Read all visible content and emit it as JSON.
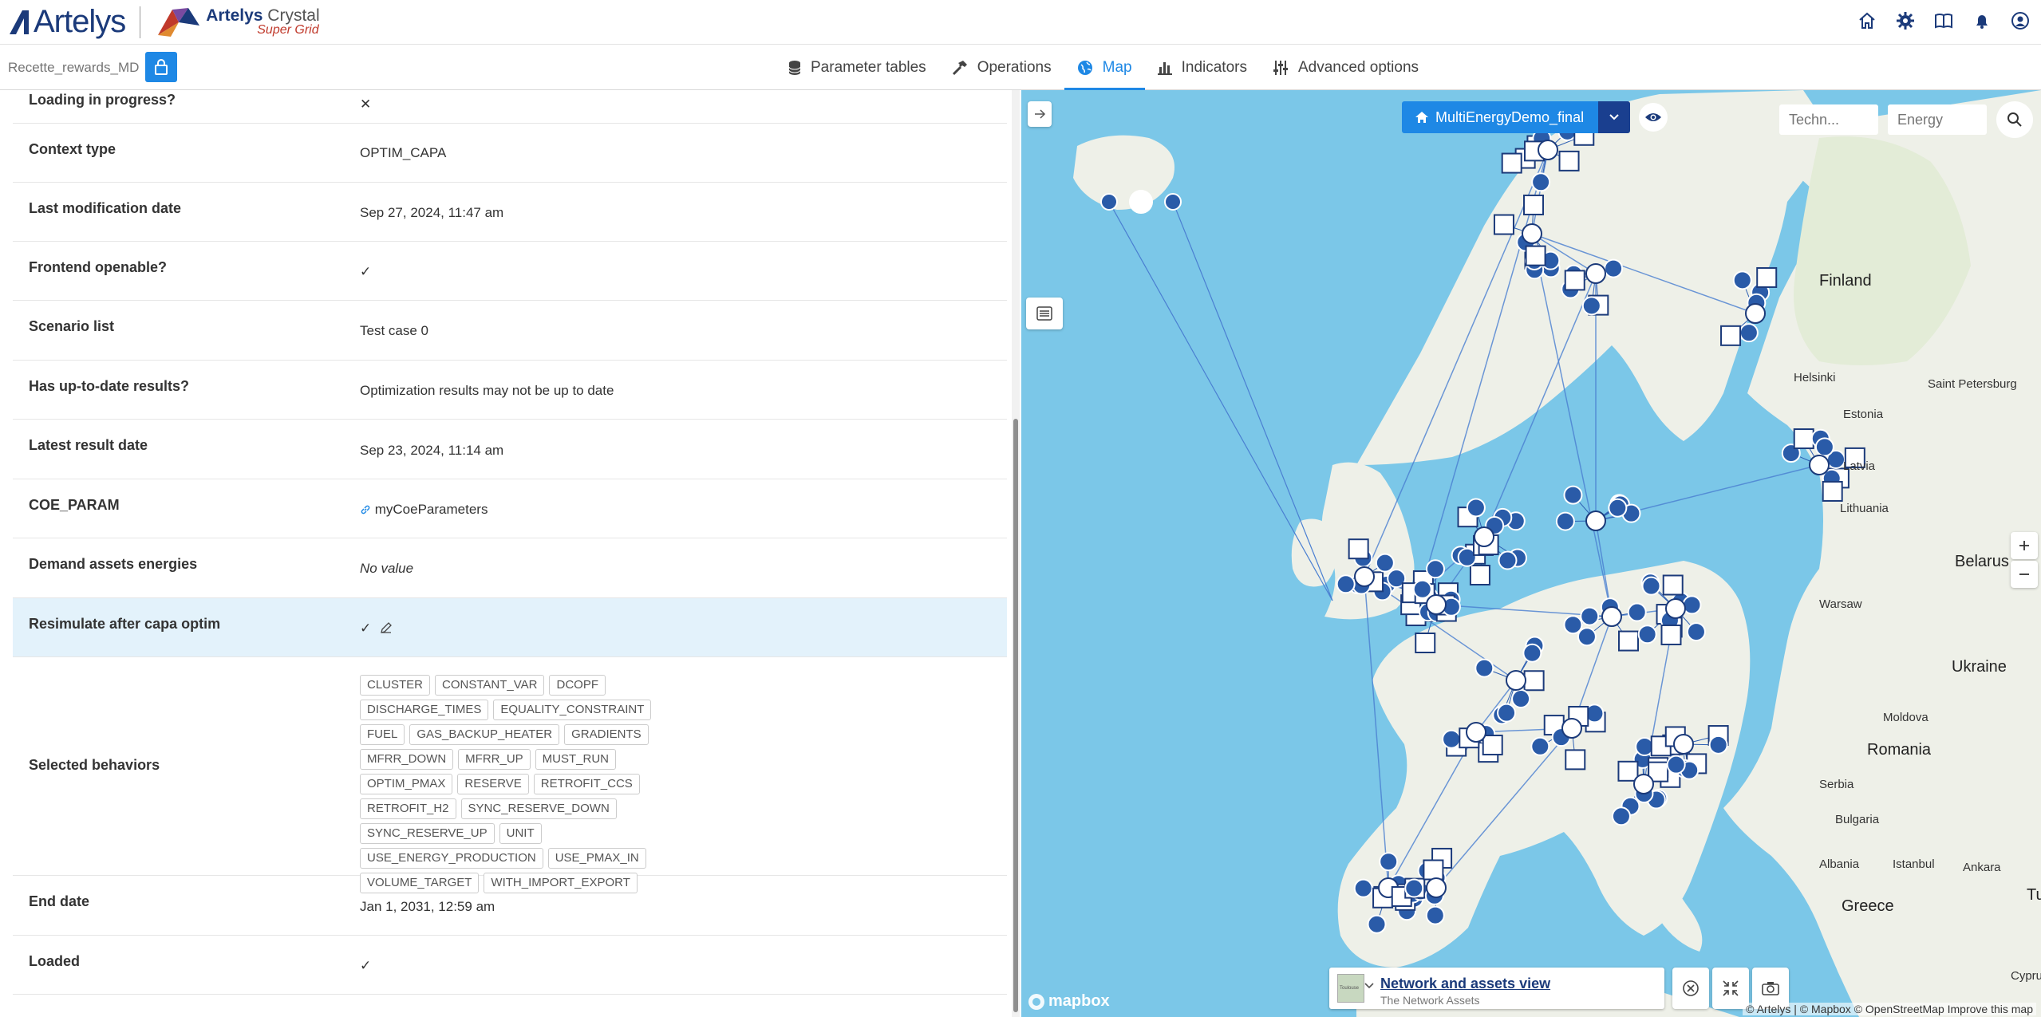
{
  "header": {
    "brand": "Artelys",
    "product_brand": "Artelys",
    "product_name": "Crystal",
    "product_sub": "Super Grid"
  },
  "toolbar": {
    "project_placeholder": "Recette_rewards_MD",
    "tabs": [
      {
        "label": "Parameter tables",
        "icon": "database-icon"
      },
      {
        "label": "Operations",
        "icon": "hammer-icon"
      },
      {
        "label": "Map",
        "icon": "globe-icon",
        "active": true
      },
      {
        "label": "Indicators",
        "icon": "bar-chart-icon"
      },
      {
        "label": "Advanced options",
        "icon": "sliders-icon"
      }
    ]
  },
  "properties": {
    "loading_label": "Loading in progress?",
    "context_type": {
      "label": "Context type",
      "value": "OPTIM_CAPA"
    },
    "last_mod": {
      "label": "Last modification date",
      "value": "Sep 27, 2024, 11:47 am"
    },
    "frontend_openable": {
      "label": "Frontend openable?",
      "value": "✓"
    },
    "scenario_list": {
      "label": "Scenario list",
      "value": "Test case 0"
    },
    "uptodate": {
      "label": "Has up-to-date results?",
      "value": "Optimization results may not be up to date"
    },
    "latest_result": {
      "label": "Latest result date",
      "value": "Sep 23, 2024, 11:14 am"
    },
    "coe_param": {
      "label": "COE_PARAM",
      "value": "myCoeParameters"
    },
    "demand_energies": {
      "label": "Demand assets energies",
      "value": "No value"
    },
    "resimulate": {
      "label": "Resimulate after capa optim",
      "value": "✓"
    },
    "behaviors": {
      "label": "Selected behaviors",
      "tags": [
        "CLUSTER",
        "CONSTANT_VAR",
        "DCOPF",
        "DISCHARGE_TIMES",
        "EQUALITY_CONSTRAINT",
        "FUEL",
        "GAS_BACKUP_HEATER",
        "GRADIENTS",
        "MFRR_DOWN",
        "MFRR_UP",
        "MUST_RUN",
        "OPTIM_PMAX",
        "RESERVE",
        "RETROFIT_CCS",
        "RETROFIT_H2",
        "SYNC_RESERVE_DOWN",
        "SYNC_RESERVE_UP",
        "UNIT",
        "USE_ENERGY_PRODUCTION",
        "USE_PMAX_IN",
        "VOLUME_TARGET",
        "WITH_IMPORT_EXPORT"
      ]
    },
    "end_date": {
      "label": "End date",
      "value": "Jan 1, 2031, 12:59 am"
    },
    "loaded": {
      "label": "Loaded",
      "value": "✓"
    }
  },
  "map": {
    "dataset_label": "MultiEnergyDemo_final",
    "tech_placeholder": "Techn...",
    "energy_placeholder": "Energy",
    "view_title": "Network and assets view",
    "view_subtitle": "The Network Assets",
    "view_thumb_label": "Toulouse",
    "copyright": "© Artelys | © Mapbox © OpenStreetMap  Improve this map",
    "mapbox_label": "mapbox",
    "places": [
      "Finland",
      "Helsinki",
      "Saint Petersburg",
      "Estonia",
      "Latvia",
      "Lithuania",
      "Belarus",
      "Warsaw",
      "Ukraine",
      "Moldova",
      "Romania",
      "Serbia",
      "Bulgaria",
      "Albania",
      "Istanbul",
      "Ankara",
      "Greece",
      "Cyprus",
      "Tu"
    ]
  }
}
